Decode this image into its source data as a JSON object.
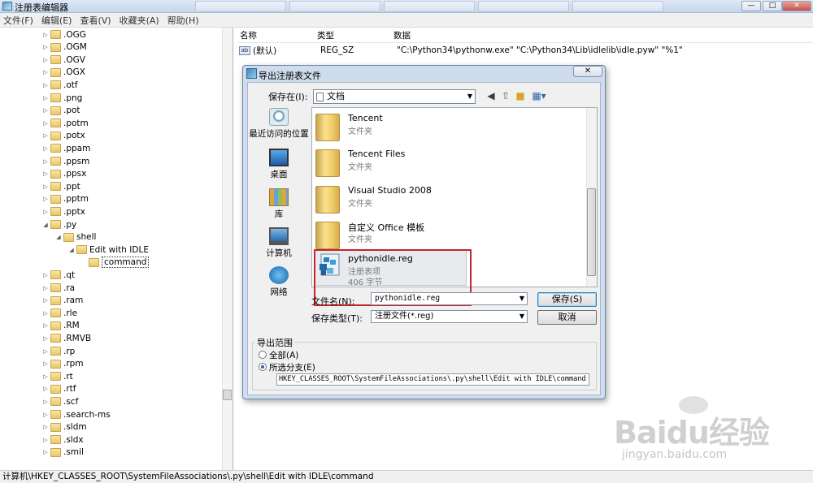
{
  "window": {
    "title": "注册表编辑器",
    "tabs": [
      "",
      "",
      "",
      "",
      "",
      ""
    ],
    "controls": {
      "min": "—",
      "max": "□",
      "close": "✕"
    }
  },
  "menu": [
    "文件(F)",
    "编辑(E)",
    "查看(V)",
    "收藏夹(A)",
    "帮助(H)"
  ],
  "tree": {
    "items": [
      {
        "label": ".OGG",
        "level": 0
      },
      {
        "label": ".OGM",
        "level": 0
      },
      {
        "label": ".OGV",
        "level": 0
      },
      {
        "label": ".OGX",
        "level": 0
      },
      {
        "label": ".otf",
        "level": 0
      },
      {
        "label": ".png",
        "level": 0
      },
      {
        "label": ".pot",
        "level": 0
      },
      {
        "label": ".potm",
        "level": 0
      },
      {
        "label": ".potx",
        "level": 0
      },
      {
        "label": ".ppam",
        "level": 0
      },
      {
        "label": ".ppsm",
        "level": 0
      },
      {
        "label": ".ppsx",
        "level": 0
      },
      {
        "label": ".ppt",
        "level": 0
      },
      {
        "label": ".pptm",
        "level": 0
      },
      {
        "label": ".pptx",
        "level": 0
      },
      {
        "label": ".py",
        "level": 0
      },
      {
        "label": "shell",
        "level": 1
      },
      {
        "label": "Edit with IDLE",
        "level": 2
      },
      {
        "label": "command",
        "level": 3
      },
      {
        "label": ".qt",
        "level": 0
      },
      {
        "label": ".ra",
        "level": 0
      },
      {
        "label": ".ram",
        "level": 0
      },
      {
        "label": ".rle",
        "level": 0
      },
      {
        "label": ".RM",
        "level": 0
      },
      {
        "label": ".RMVB",
        "level": 0
      },
      {
        "label": ".rp",
        "level": 0
      },
      {
        "label": ".rpm",
        "level": 0
      },
      {
        "label": ".rt",
        "level": 0
      },
      {
        "label": ".rtf",
        "level": 0
      },
      {
        "label": ".scf",
        "level": 0
      },
      {
        "label": ".search-ms",
        "level": 0
      },
      {
        "label": ".sldm",
        "level": 0
      },
      {
        "label": ".sldx",
        "level": 0
      },
      {
        "label": ".smil",
        "level": 0
      }
    ]
  },
  "values": {
    "headers": {
      "name": "名称",
      "type": "类型",
      "data": "数据"
    },
    "row": {
      "icon": "ab",
      "name": "(默认)",
      "type": "REG_SZ",
      "data": "\"C:\\Python34\\pythonw.exe\" \"C:\\Python34\\Lib\\idlelib\\idle.pyw\" \"%1\""
    }
  },
  "status": "计算机\\HKEY_CLASSES_ROOT\\SystemFileAssociations\\.py\\shell\\Edit with IDLE\\command",
  "dialog": {
    "title": "导出注册表文件",
    "close": "✕",
    "save_in_label": "保存在(I):",
    "save_in_value": "文档",
    "places": [
      "最近访问的位置",
      "桌面",
      "库",
      "计算机",
      "网络"
    ],
    "files": [
      {
        "name": "Tencent",
        "type": "文件夹"
      },
      {
        "name": "Tencent Files",
        "type": "文件夹"
      },
      {
        "name": "Visual Studio 2008",
        "type": "文件夹"
      },
      {
        "name": "自定义 Office 模板",
        "type": "文件夹"
      }
    ],
    "reg_file": {
      "name": "pythonidle.reg",
      "type": "注册表项",
      "size": "406 字节"
    },
    "filename_label": "文件名(N):",
    "filename_value": "pythonidle.reg",
    "filetype_label": "保存类型(T):",
    "filetype_value": "注册文件(*.reg)",
    "save_button": "保存(S)",
    "cancel_button": "取消",
    "range_label": "导出范围",
    "range_all": "全部(A)",
    "range_branch": "所选分支(E)",
    "branch_value": "HKEY_CLASSES_ROOT\\SystemFileAssociations\\.py\\shell\\Edit with IDLE\\command"
  },
  "watermark": {
    "logo": "Baidu经验",
    "url": "jingyan.baidu.com"
  }
}
